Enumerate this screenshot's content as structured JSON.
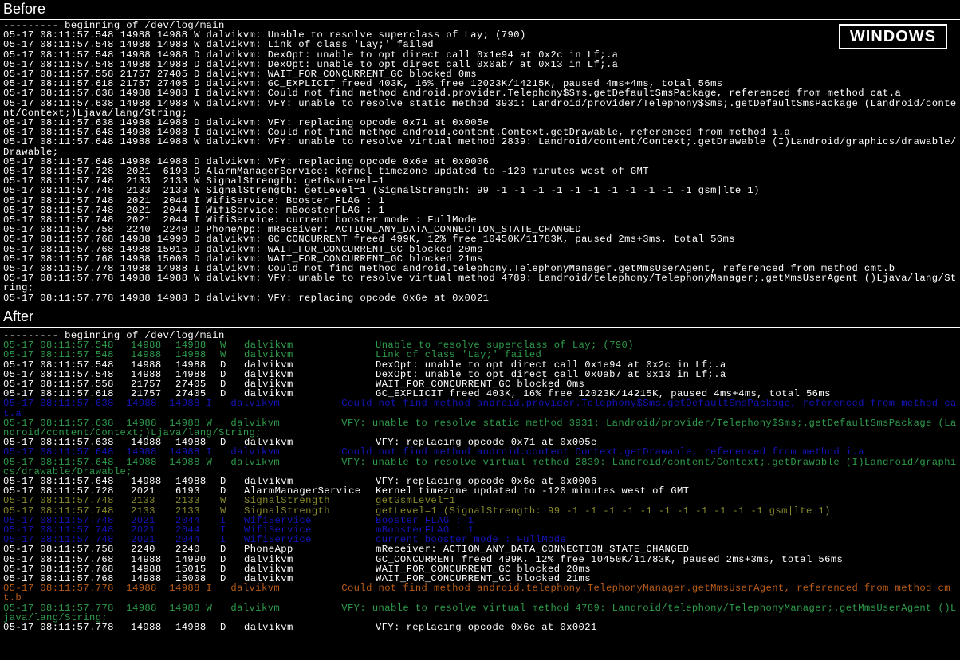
{
  "labels": {
    "before": "Before",
    "after": "After",
    "badge": "WINDOWS"
  },
  "before_lines": [
    "--------- beginning of /dev/log/main",
    "05-17 08:11:57.548 14988 14988 W dalvikvm: Unable to resolve superclass of Lay; (790)",
    "05-17 08:11:57.548 14988 14988 W dalvikvm: Link of class 'Lay;' failed",
    "05-17 08:11:57.548 14988 14988 D dalvikvm: DexOpt: unable to opt direct call 0x1e94 at 0x2c in Lf;.a",
    "05-17 08:11:57.548 14988 14988 D dalvikvm: DexOpt: unable to opt direct call 0x0ab7 at 0x13 in Lf;.a",
    "05-17 08:11:57.558 21757 27405 D dalvikvm: WAIT_FOR_CONCURRENT_GC blocked 0ms",
    "05-17 08:11:57.618 21757 27405 D dalvikvm: GC_EXPLICIT freed 403K, 16% free 12023K/14215K, paused 4ms+4ms, total 56ms",
    "05-17 08:11:57.638 14988 14988 I dalvikvm: Could not find method android.provider.Telephony$Sms.getDefaultSmsPackage, referenced from method cat.a",
    "05-17 08:11:57.638 14988 14988 W dalvikvm: VFY: unable to resolve static method 3931: Landroid/provider/Telephony$Sms;.getDefaultSmsPackage (Landroid/content/Context;)Ljava/lang/String;",
    "05-17 08:11:57.638 14988 14988 D dalvikvm: VFY: replacing opcode 0x71 at 0x005e",
    "05-17 08:11:57.648 14988 14988 I dalvikvm: Could not find method android.content.Context.getDrawable, referenced from method i.a",
    "05-17 08:11:57.648 14988 14988 W dalvikvm: VFY: unable to resolve virtual method 2839: Landroid/content/Context;.getDrawable (I)Landroid/graphics/drawable/Drawable;",
    "05-17 08:11:57.648 14988 14988 D dalvikvm: VFY: replacing opcode 0x6e at 0x0006",
    "05-17 08:11:57.728  2021  6193 D AlarmManagerService: Kernel timezone updated to -120 minutes west of GMT",
    "05-17 08:11:57.748  2133  2133 W SignalStrength: getGsmLevel=1",
    "05-17 08:11:57.748  2133  2133 W SignalStrength: getLevel=1 (SignalStrength: 99 -1 -1 -1 -1 -1 -1 -1 -1 -1 -1 -1 gsm|lte 1)",
    "05-17 08:11:57.748  2021  2044 I WifiService: Booster FLAG : 1",
    "05-17 08:11:57.748  2021  2044 I WifiService: mBoosterFLAG : 1",
    "05-17 08:11:57.748  2021  2044 I WifiService: current booster mode : FullMode",
    "05-17 08:11:57.758  2240  2240 D PhoneApp: mReceiver: ACTION_ANY_DATA_CONNECTION_STATE_CHANGED",
    "05-17 08:11:57.768 14988 14990 D dalvikvm: GC_CONCURRENT freed 499K, 12% free 10450K/11783K, paused 2ms+3ms, total 56ms",
    "05-17 08:11:57.768 14988 15015 D dalvikvm: WAIT_FOR_CONCURRENT_GC blocked 20ms",
    "05-17 08:11:57.768 14988 15008 D dalvikvm: WAIT_FOR_CONCURRENT_GC blocked 21ms",
    "05-17 08:11:57.778 14988 14988 I dalvikvm: Could not find method android.telephony.TelephonyManager.getMmsUserAgent, referenced from method cmt.b",
    "05-17 08:11:57.778 14988 14988 W dalvikvm: VFY: unable to resolve virtual method 4789: Landroid/telephony/TelephonyManager;.getMmsUserAgent ()Ljava/lang/String;",
    "05-17 08:11:57.778 14988 14988 D dalvikvm: VFY: replacing opcode 0x6e at 0x0021"
  ],
  "after_lines": [
    {
      "cls": "",
      "cols": [
        "--------- beginning of /dev/log/main"
      ]
    },
    {
      "cls": "green",
      "cols": [
        "05-17 08:11:57.548",
        "14988",
        "14988",
        "W",
        "dalvikvm",
        "Unable to resolve superclass of Lay; (790)"
      ]
    },
    {
      "cls": "green",
      "cols": [
        "05-17 08:11:57.548",
        "14988",
        "14988",
        "W",
        "dalvikvm",
        "Link of class 'Lay;' failed"
      ]
    },
    {
      "cls": "",
      "cols": [
        "05-17 08:11:57.548",
        "14988",
        "14988",
        "D",
        "dalvikvm",
        "DexOpt: unable to opt direct call 0x1e94 at 0x2c in Lf;.a"
      ]
    },
    {
      "cls": "",
      "cols": [
        "05-17 08:11:57.548",
        "14988",
        "14988",
        "D",
        "dalvikvm",
        "DexOpt: unable to opt direct call 0x0ab7 at 0x13 in Lf;.a"
      ]
    },
    {
      "cls": "",
      "cols": [
        "05-17 08:11:57.558",
        "21757",
        "27405",
        "D",
        "dalvikvm",
        "WAIT_FOR_CONCURRENT_GC blocked 0ms"
      ]
    },
    {
      "cls": "",
      "cols": [
        "05-17 08:11:57.618",
        "21757",
        "27405",
        "D",
        "dalvikvm",
        "GC_EXPLICIT freed 403K, 16% free 12023K/14215K, paused 4ms+4ms, total 56ms"
      ]
    },
    {
      "cls": "darkblue",
      "wrap": "05-17 08:11:57.638  14988  14988 I   dalvikvm          Could not find method android.provider.Telephony$Sms.getDefaultSmsPackage, referenced from method cat.a"
    },
    {
      "cls": "green",
      "wrap": "05-17 08:11:57.638  14988  14988 W   dalvikvm          VFY: unable to resolve static method 3931: Landroid/provider/Telephony$Sms;.getDefaultSmsPackage (Landroid/content/Context;)Ljava/lang/String;"
    },
    {
      "cls": "",
      "cols": [
        "05-17 08:11:57.638",
        "14988",
        "14988",
        "D",
        "dalvikvm",
        "VFY: replacing opcode 0x71 at 0x005e"
      ]
    },
    {
      "cls": "darkblue",
      "wrap": "05-17 08:11:57.648  14988  14988 I   dalvikvm          Could not find method android.content.Context.getDrawable, referenced from method i.a"
    },
    {
      "cls": "green",
      "wrap": "05-17 08:11:57.648  14988  14988 W   dalvikvm          VFY: unable to resolve virtual method 2839: Landroid/content/Context;.getDrawable (I)Landroid/graphics/drawable/Drawable;"
    },
    {
      "cls": "",
      "cols": [
        "05-17 08:11:57.648",
        "14988",
        "14988",
        "D",
        "dalvikvm",
        "VFY: replacing opcode 0x6e at 0x0006"
      ]
    },
    {
      "cls": "",
      "cols": [
        "05-17 08:11:57.728",
        "2021",
        "6193",
        "D",
        "AlarmManagerService",
        "Kernel timezone updated to -120 minutes west of GMT"
      ]
    },
    {
      "cls": "olive",
      "cols": [
        "05-17 08:11:57.748",
        "2133",
        "2133",
        "W",
        "SignalStrength",
        "getGsmLevel=1"
      ]
    },
    {
      "cls": "olive",
      "cols": [
        "05-17 08:11:57.748",
        "2133",
        "2133",
        "W",
        "SignalStrength",
        "getLevel=1 (SignalStrength: 99 -1 -1 -1 -1 -1 -1 -1 -1 -1 -1 -1 gsm|lte 1)"
      ]
    },
    {
      "cls": "darkblue",
      "cols": [
        "05-17 08:11:57.748",
        "2021",
        "2044",
        "I",
        "WifiService",
        "Booster FLAG : 1"
      ]
    },
    {
      "cls": "darkblue",
      "cols": [
        "05-17 08:11:57.748",
        "2021",
        "2044",
        "I",
        "WifiService",
        "mBoosterFLAG : 1"
      ]
    },
    {
      "cls": "darkblue",
      "cols": [
        "05-17 08:11:57.748",
        "2021",
        "2044",
        "I",
        "WifiService",
        "current booster mode : FullMode"
      ]
    },
    {
      "cls": "",
      "cols": [
        "05-17 08:11:57.758",
        "2240",
        "2240",
        "D",
        "PhoneApp",
        "mReceiver: ACTION_ANY_DATA_CONNECTION_STATE_CHANGED"
      ]
    },
    {
      "cls": "",
      "cols": [
        "05-17 08:11:57.768",
        "14988",
        "14990",
        "D",
        "dalvikvm",
        "GC_CONCURRENT freed 499K, 12% free 10450K/11783K, paused 2ms+3ms, total 56ms"
      ]
    },
    {
      "cls": "",
      "cols": [
        "05-17 08:11:57.768",
        "14988",
        "15015",
        "D",
        "dalvikvm",
        "WAIT_FOR_CONCURRENT_GC blocked 20ms"
      ]
    },
    {
      "cls": "",
      "cols": [
        "05-17 08:11:57.768",
        "14988",
        "15008",
        "D",
        "dalvikvm",
        "WAIT_FOR_CONCURRENT_GC blocked 21ms"
      ]
    },
    {
      "cls": "orange",
      "wrap": "05-17 08:11:57.778  14988  14988 I   dalvikvm          Could not find method android.telephony.TelephonyManager.getMmsUserAgent, referenced from method cmt.b"
    },
    {
      "cls": "green",
      "wrap": "05-17 08:11:57.778  14988  14988 W   dalvikvm          VFY: unable to resolve virtual method 4789: Landroid/telephony/TelephonyManager;.getMmsUserAgent ()Ljava/lang/String;"
    },
    {
      "cls": "",
      "cols": [
        "05-17 08:11:57.778",
        "14988",
        "14988",
        "D",
        "dalvikvm",
        "VFY: replacing opcode 0x6e at 0x0021"
      ]
    }
  ]
}
